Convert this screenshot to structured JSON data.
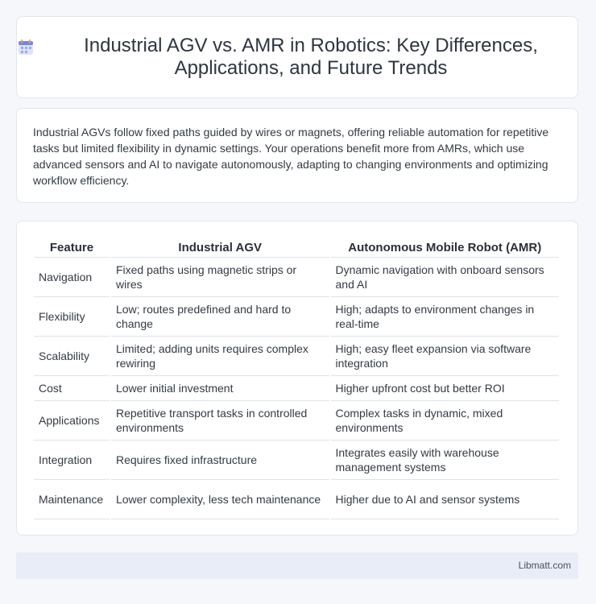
{
  "header": {
    "title": "Industrial AGV vs. AMR in Robotics: Key Differences, Applications, and Future Trends",
    "icon": "calendar-icon"
  },
  "intro": {
    "text": "Industrial AGVs follow fixed paths guided by wires or magnets, offering reliable automation for repetitive tasks but limited flexibility in dynamic settings. Your operations benefit more from AMRs, which use advanced sensors and AI to navigate autonomously, adapting to changing environments and optimizing workflow efficiency."
  },
  "table": {
    "headers": [
      "Feature",
      "Industrial AGV",
      "Autonomous Mobile Robot (AMR)"
    ],
    "rows": [
      {
        "feature": "Navigation",
        "agv": "Fixed paths using magnetic strips or wires",
        "amr": "Dynamic navigation with onboard sensors and AI"
      },
      {
        "feature": "Flexibility",
        "agv": "Low; routes predefined and hard to change",
        "amr": "High; adapts to environment changes in real-time"
      },
      {
        "feature": "Scalability",
        "agv": "Limited; adding units requires complex rewiring",
        "amr": "High; easy fleet expansion via software integration"
      },
      {
        "feature": "Cost",
        "agv": "Lower initial investment",
        "amr": "Higher upfront cost but better ROI"
      },
      {
        "feature": "Applications",
        "agv": "Repetitive transport tasks in controlled environments",
        "amr": "Complex tasks in dynamic, mixed environments"
      },
      {
        "feature": "Integration",
        "agv": "Requires fixed infrastructure",
        "amr": "Integrates easily with warehouse management systems"
      },
      {
        "feature": "Maintenance",
        "agv": "Lower complexity, less tech maintenance",
        "amr": "Higher due to AI and sensor systems"
      }
    ]
  },
  "footer": {
    "text": "Libmatt.com"
  }
}
